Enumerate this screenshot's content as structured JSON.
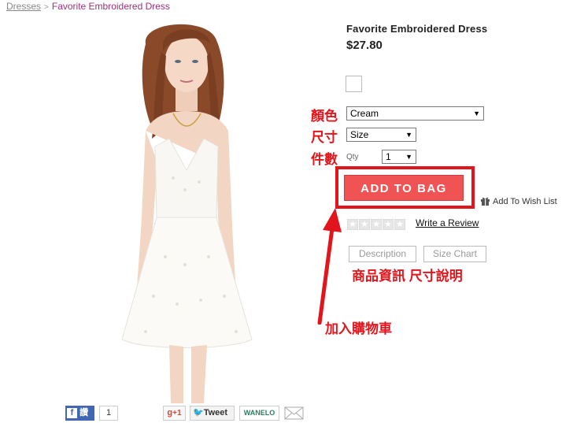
{
  "breadcrumb": {
    "parent": "Dresses",
    "separator": ">",
    "current": "Favorite Embroidered Dress"
  },
  "product": {
    "title": "Favorite Embroidered Dress",
    "price": "$27.80",
    "color_select": "Cream",
    "size_select": "Size",
    "qty_label": "Qty",
    "qty_value": "1",
    "add_to_bag": "ADD TO BAG",
    "wishlist": "Add To Wish List",
    "write_review": "Write a Review",
    "rating_stars": 0,
    "rating_max": 5
  },
  "tabs": {
    "description": "Description",
    "size_chart": "Size Chart"
  },
  "annotations": {
    "color": "顏色",
    "size": "尺寸",
    "quantity": "件數",
    "tabs_note": "商品資訊 尺寸說明",
    "add_to_cart_note": "加入購物車"
  },
  "share": {
    "facebook_label": "讚",
    "facebook_count": "1",
    "gplus_label": "+1",
    "tweet_label": "Tweet",
    "wanelo_label": "WANELO"
  },
  "colors": {
    "accent_pink": "#a0307a",
    "add_to_bag_bg": "#f05354",
    "annotation_red": "#e3151c"
  }
}
